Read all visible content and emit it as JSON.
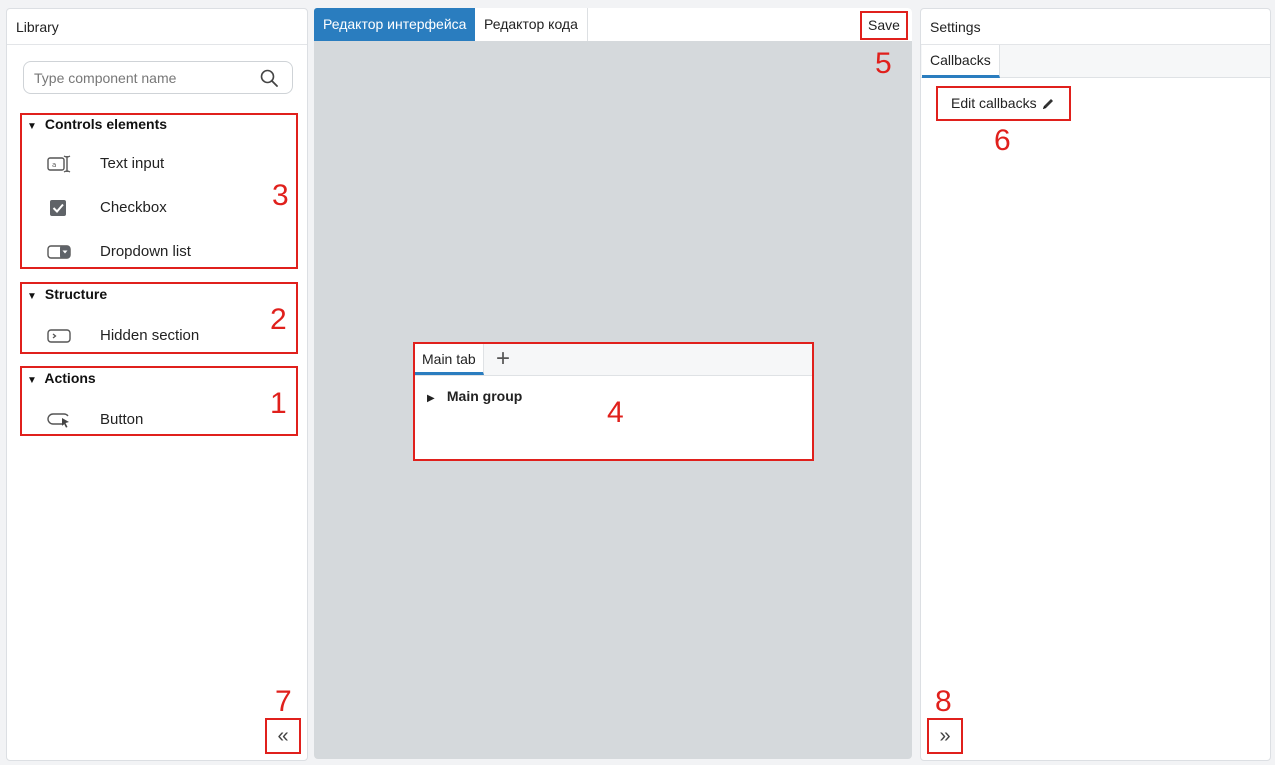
{
  "library": {
    "title": "Library",
    "search_placeholder": "Type component name",
    "groups": [
      {
        "name": "Controls elements",
        "callout": "3",
        "items": [
          {
            "label": "Text input",
            "icon": "text-input-icon"
          },
          {
            "label": "Checkbox",
            "icon": "checkbox-icon"
          },
          {
            "label": "Dropdown list",
            "icon": "dropdown-list-icon"
          }
        ]
      },
      {
        "name": "Structure",
        "callout": "2",
        "items": [
          {
            "label": "Hidden section",
            "icon": "hidden-section-icon"
          }
        ]
      },
      {
        "name": "Actions",
        "callout": "1",
        "items": [
          {
            "label": "Button",
            "icon": "button-icon"
          }
        ]
      }
    ],
    "collapse_callout": "7",
    "collapse_glyph": "«"
  },
  "editor": {
    "tabs": [
      "Редактор интерфейса",
      "Редактор кода"
    ],
    "save_label": "Save",
    "save_callout": "5",
    "canvas": {
      "tab_label": "Main tab",
      "add_tab_glyph": "+",
      "group_label": "Main group",
      "callout": "4"
    }
  },
  "settings": {
    "title": "Settings",
    "tab_label": "Callbacks",
    "edit_label": "Edit callbacks",
    "edit_callout": "6",
    "expand_callout": "8",
    "expand_glyph": "»"
  },
  "colors": {
    "accent": "#2a7dbf",
    "annotation": "#e0201c",
    "canvas_bg": "#d5d9dc"
  }
}
